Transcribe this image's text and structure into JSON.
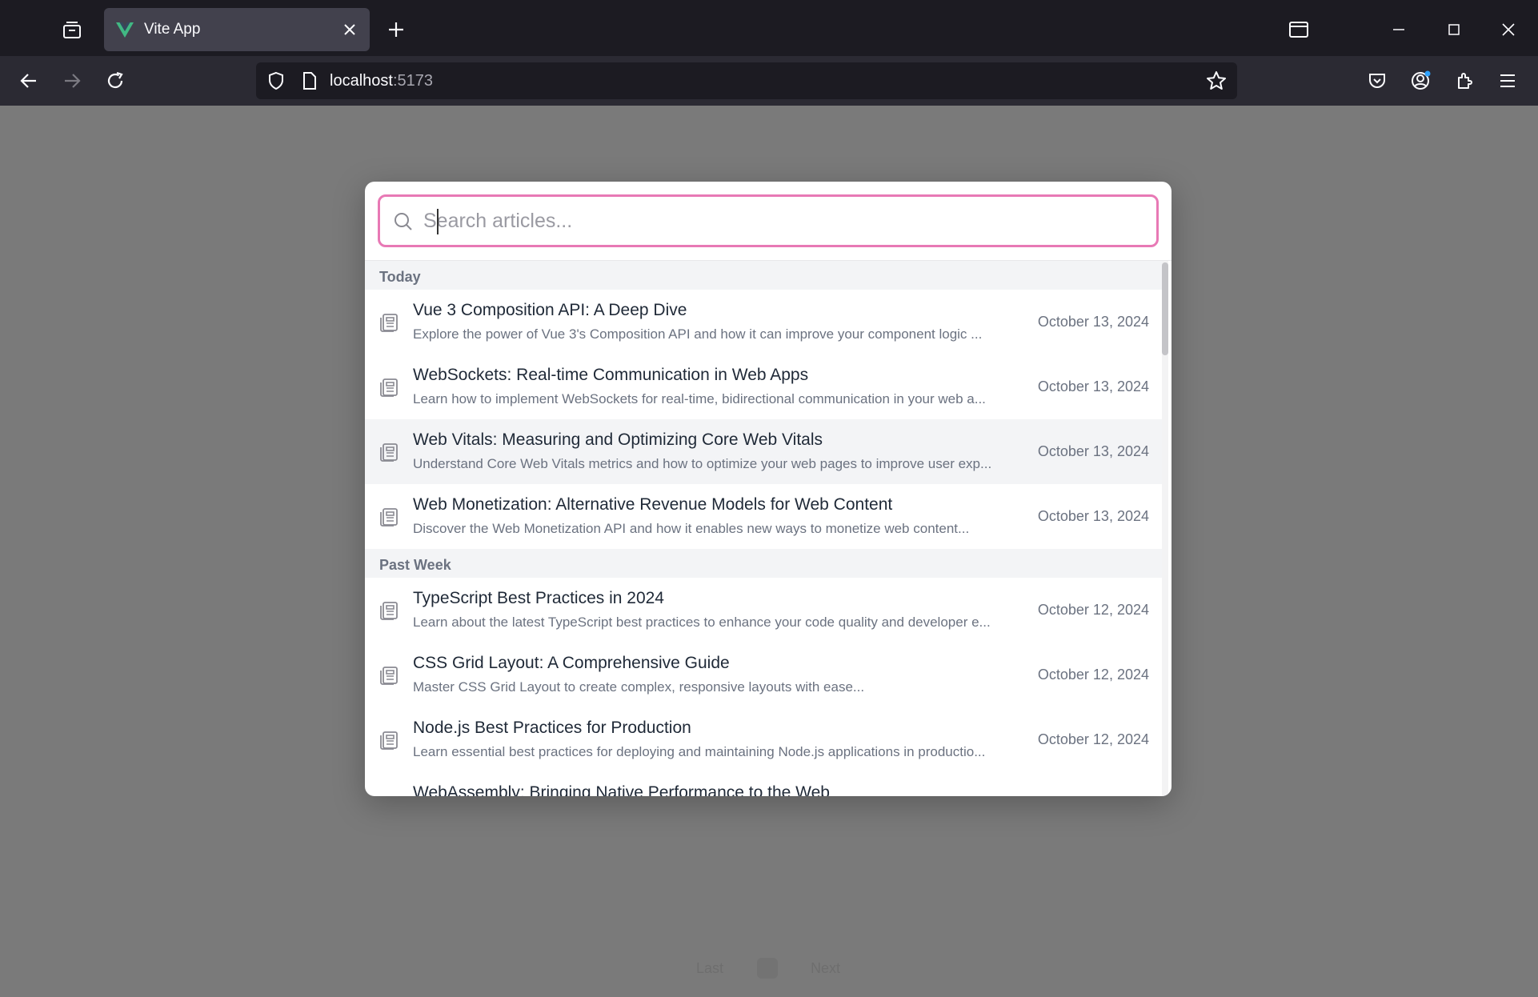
{
  "browser": {
    "tab_title": "Vite App",
    "url_host": "localhost",
    "url_port": ":5173",
    "icons": {
      "tab_list": "tab-list-icon",
      "tab_close": "close-icon",
      "new_tab": "plus-icon",
      "back": "back-arrow-icon",
      "forward": "forward-arrow-icon",
      "reload": "reload-icon",
      "tracking": "shield-icon",
      "page": "page-icon",
      "bookmark": "star-icon",
      "pocket": "pocket-icon",
      "account": "account-icon",
      "extensions": "puzzle-icon",
      "menu": "hamburger-icon"
    }
  },
  "search": {
    "placeholder": "Search articles...",
    "value": ""
  },
  "groups": [
    {
      "label": "Today",
      "items": [
        {
          "title": "Vue 3 Composition API: A Deep Dive",
          "excerpt": "Explore the power of Vue 3's Composition API and how it can improve your component logic ...",
          "date": "October 13, 2024"
        },
        {
          "title": "WebSockets: Real-time Communication in Web Apps",
          "excerpt": "Learn how to implement WebSockets for real-time, bidirectional communication in your web a...",
          "date": "October 13, 2024"
        },
        {
          "title": "Web Vitals: Measuring and Optimizing Core Web Vitals",
          "excerpt": "Understand Core Web Vitals metrics and how to optimize your web pages to improve user exp...",
          "date": "October 13, 2024"
        },
        {
          "title": "Web Monetization: Alternative Revenue Models for Web Content",
          "excerpt": "Discover the Web Monetization API and how it enables new ways to monetize web content...",
          "date": "October 13, 2024"
        }
      ]
    },
    {
      "label": "Past Week",
      "items": [
        {
          "title": "TypeScript Best Practices in 2024",
          "excerpt": "Learn about the latest TypeScript best practices to enhance your code quality and developer e...",
          "date": "October 12, 2024"
        },
        {
          "title": "CSS Grid Layout: A Comprehensive Guide",
          "excerpt": "Master CSS Grid Layout to create complex, responsive layouts with ease...",
          "date": "October 12, 2024"
        },
        {
          "title": "Node.js Best Practices for Production",
          "excerpt": "Learn essential best practices for deploying and maintaining Node.js applications in productio...",
          "date": "October 12, 2024"
        },
        {
          "title": "WebAssembly: Bringing Native Performance to the Web",
          "excerpt": "",
          "date": ""
        }
      ]
    }
  ],
  "pager": {
    "prev_label": "Last",
    "next_label": "Next"
  },
  "colors": {
    "accent_border": "#e879b5",
    "overlay": "#7a7a7a",
    "vue_green": "#41b883"
  }
}
